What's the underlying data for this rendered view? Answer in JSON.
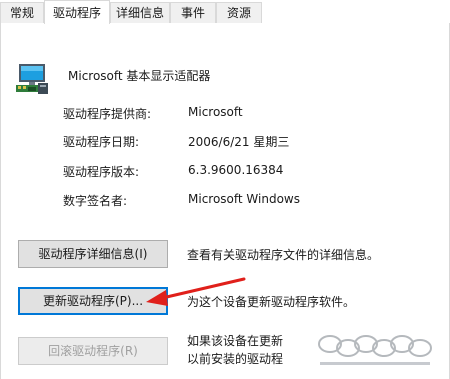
{
  "tabs": [
    {
      "label": "常规"
    },
    {
      "label": "驱动程序"
    },
    {
      "label": "详细信息"
    },
    {
      "label": "事件"
    },
    {
      "label": "资源"
    }
  ],
  "device": {
    "name": "Microsoft 基本显示适配器",
    "icon": "display-adapter-icon"
  },
  "info": [
    {
      "label": "驱动程序提供商:",
      "value": "Microsoft"
    },
    {
      "label": "驱动程序日期:",
      "value": "2006/6/21 星期三"
    },
    {
      "label": "驱动程序版本:",
      "value": "6.3.9600.16384"
    },
    {
      "label": "数字签名者:",
      "value": "Microsoft Windows"
    }
  ],
  "actions": [
    {
      "button": "驱动程序详细信息(I)",
      "description": "查看有关驱动程序文件的详细信息。"
    },
    {
      "button": "更新驱动程序(P)...",
      "description": "为这个设备更新驱动程序软件。"
    },
    {
      "button": "回滚驱动程序(R)",
      "description_lines": [
        "如果该设备在更新",
        "以前安装的驱动程"
      ]
    }
  ],
  "colors": {
    "arrow": "#e0201b",
    "focus": "#0078d7"
  }
}
